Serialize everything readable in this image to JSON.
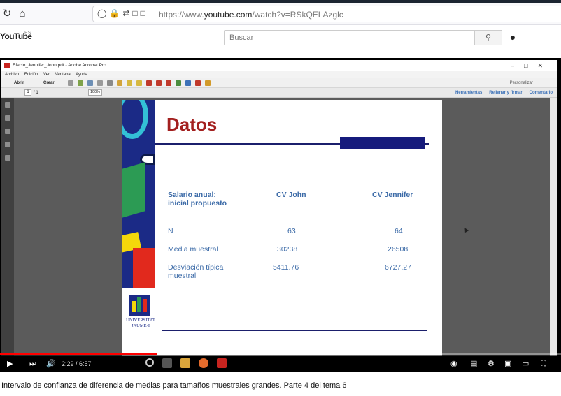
{
  "browser": {
    "url_prefix": "https://www.",
    "url_host": "youtube.com",
    "url_path": "/watch?v=RSkQELAzglc"
  },
  "youtube": {
    "logo": "YouTube",
    "region": "ES",
    "search_placeholder": "Buscar"
  },
  "acrobat": {
    "window_title": "Efecto_Jennifer_John.pdf - Adobe Acrobat Pro",
    "menu": [
      "Archivo",
      "Edición",
      "Ver",
      "Ventana",
      "Ayuda"
    ],
    "toolbar": {
      "open": "Abrir",
      "create": "Crear",
      "customize": "Personalizar"
    },
    "page": {
      "current": "1",
      "total": "/ 1",
      "zoom": "100%"
    },
    "panels": [
      "Herramientas",
      "Rellenar y firmar",
      "Comentario"
    ]
  },
  "slide": {
    "title": "Datos",
    "header_label": "Salario anual:\ninicial propuesto",
    "col_john": "CV John",
    "col_jennifer": "CV Jennifer",
    "rows": [
      {
        "label": "N",
        "john": "63",
        "jennifer": "64"
      },
      {
        "label": "Media muestral",
        "john": "30238",
        "jennifer": "26508"
      },
      {
        "label": "Desviación típica\nmuestral",
        "john": "5411.76",
        "jennifer": "6727.27"
      }
    ],
    "logo_line1": "UNIVERSITAT",
    "logo_line2": "JAUME•I"
  },
  "player": {
    "time": "2:29 / 6:57",
    "progress_fraction": 0.28
  },
  "video": {
    "title": "Intervalo de confianza de diferencia de medias para tamaños muestrales grandes. Parte 4 del tema 6"
  },
  "colors": {
    "slide_title": "#a3201f",
    "slide_text": "#3b6aa7",
    "slide_navy": "#1b1f6c",
    "progress": "#ff0000"
  }
}
